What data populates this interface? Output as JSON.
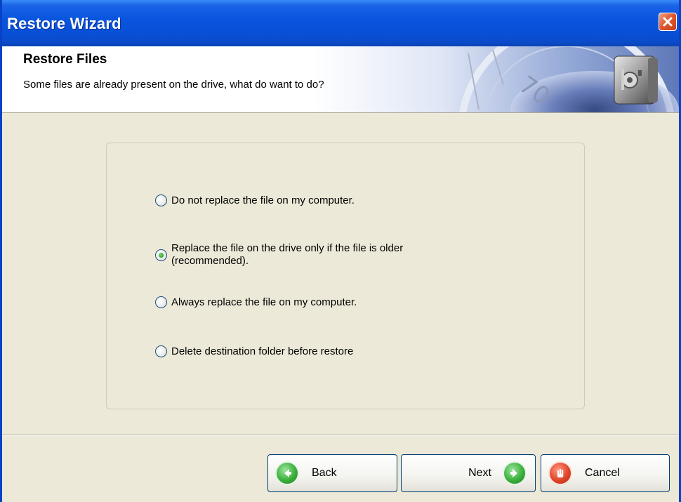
{
  "window": {
    "title": "Restore Wizard"
  },
  "banner": {
    "title": "Restore Files",
    "subtitle": "Some files are already present on the drive, what do want to do?"
  },
  "options": [
    {
      "label": "Do not replace the file on my computer.",
      "checked": false
    },
    {
      "label": "Replace the file on the drive only if the file is older (recommended).",
      "checked": true
    },
    {
      "label": "Always replace the file on my computer.",
      "checked": false
    },
    {
      "label": "Delete destination folder before restore",
      "checked": false
    }
  ],
  "buttons": {
    "back": "Back",
    "next": "Next",
    "cancel": "Cancel"
  },
  "colors": {
    "title_bar": "#0a55de",
    "close": "#e0552a",
    "radio_selected": "#2ea42e",
    "nav_icon": "#2f9c2f",
    "cancel_icon": "#d33a1b"
  }
}
